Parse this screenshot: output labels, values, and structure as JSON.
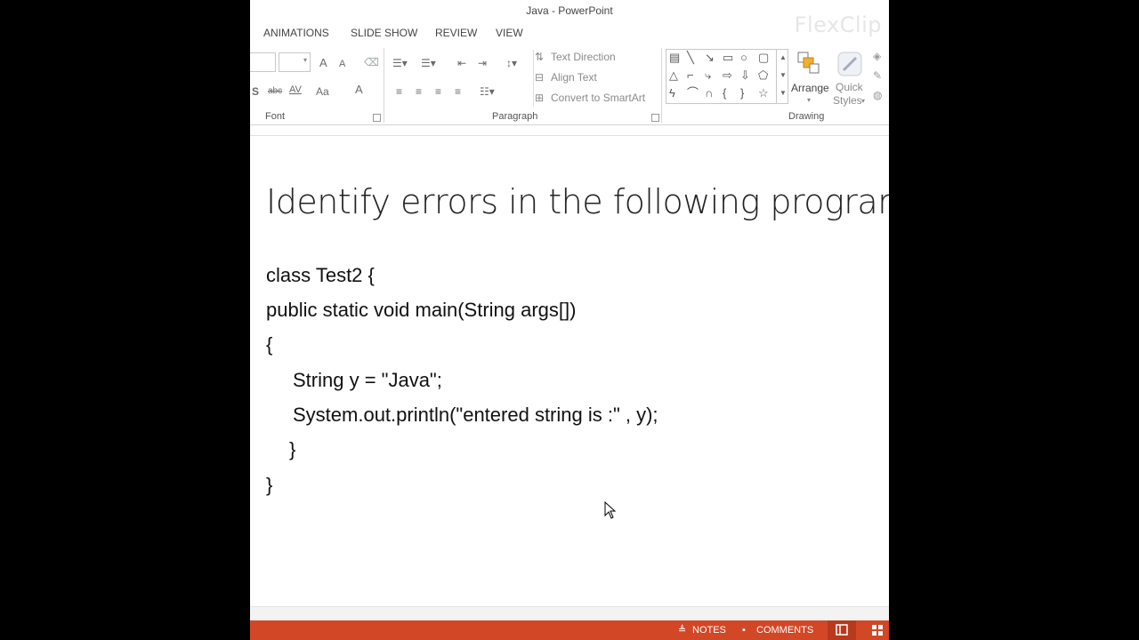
{
  "window": {
    "title": "Java - PowerPoint",
    "watermark": "FlexClip"
  },
  "tabs": [
    {
      "label": "ANIMATIONS"
    },
    {
      "label": "SLIDE SHOW"
    },
    {
      "label": "REVIEW"
    },
    {
      "label": "VIEW"
    }
  ],
  "ribbon": {
    "font_group": {
      "label": "Font",
      "icons": [
        "A",
        "A",
        "S",
        "abc",
        "AV",
        "Aa",
        "A"
      ]
    },
    "paragraph_group": {
      "label": "Paragraph",
      "text_direction": "Text Direction",
      "align_text": "Align Text",
      "convert_smartart": "Convert to SmartArt"
    },
    "drawing_group": {
      "label": "Drawing",
      "arrange": "Arrange",
      "quick_styles_line1": "Quick",
      "quick_styles_line2": "Styles"
    }
  },
  "slide": {
    "title": "Identify errors in the following program",
    "code_lines": [
      "class Test2 {",
      "public static void main(String args[])",
      "{",
      "String y = \"Java\";",
      "System.out.println(\"entered string is :\" , y);",
      "}",
      "}"
    ]
  },
  "statusbar": {
    "notes": "NOTES",
    "comments": "COMMENTS"
  },
  "colors": {
    "accent": "#d24726",
    "text": "#222222"
  }
}
